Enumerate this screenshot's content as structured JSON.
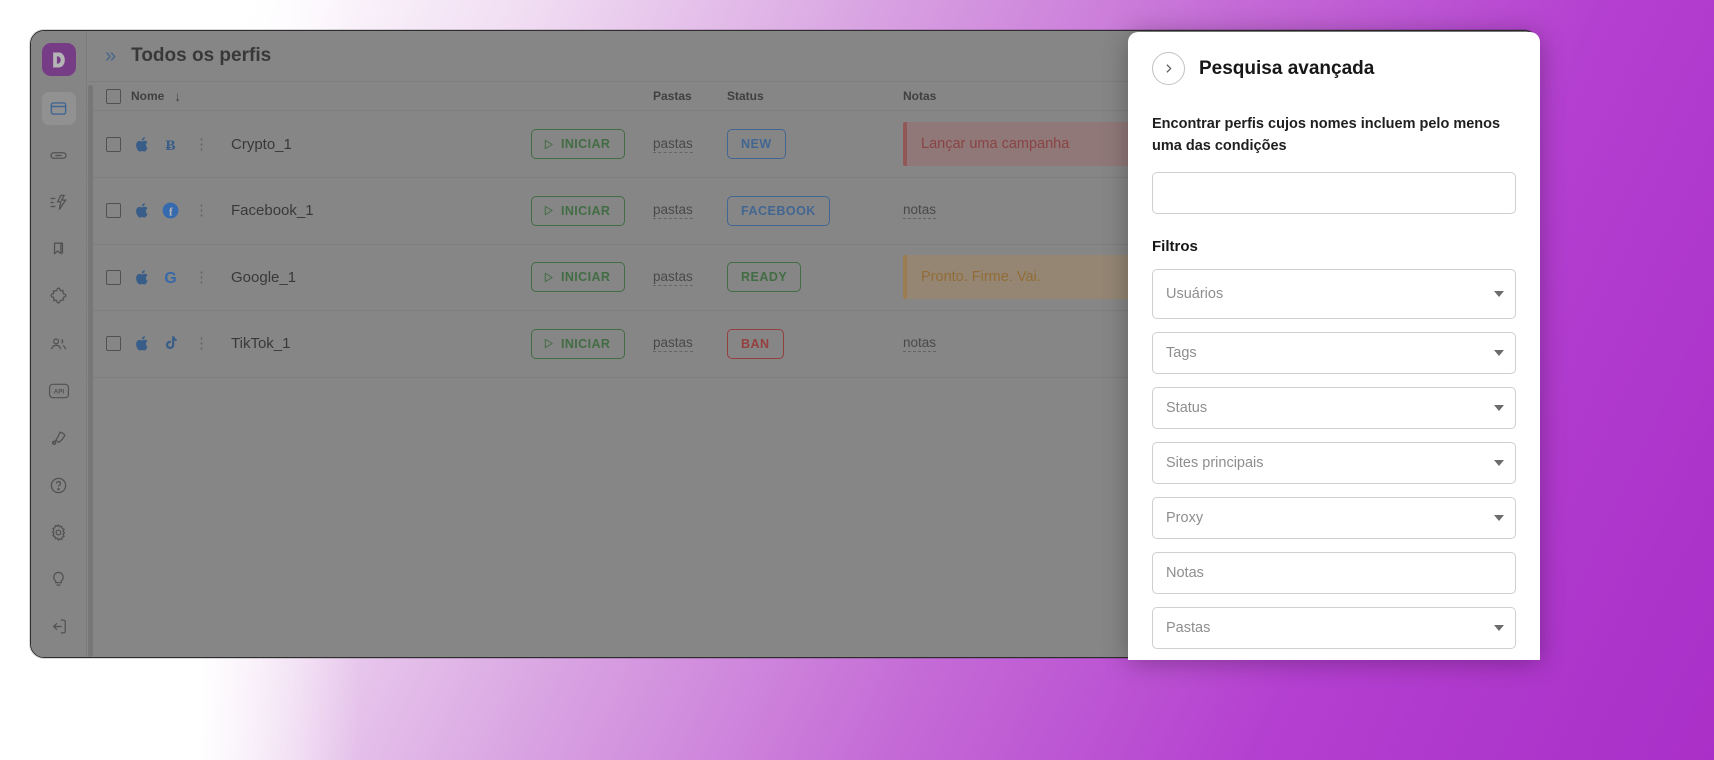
{
  "app": {
    "logo_icon": "dolphin-anty-logo",
    "sidebar_items": [
      {
        "icon": "browser-profiles-icon",
        "name": "sidebar-item-profiles",
        "active": true
      },
      {
        "icon": "link-icon",
        "name": "sidebar-item-proxies",
        "active": false
      },
      {
        "icon": "automation-icon",
        "name": "sidebar-item-automation",
        "active": false
      },
      {
        "icon": "bookmarks-icon",
        "name": "sidebar-item-bookmarks",
        "active": false
      },
      {
        "icon": "extension-puzzle-icon",
        "name": "sidebar-item-extensions",
        "active": false
      },
      {
        "icon": "team-users-icon",
        "name": "sidebar-item-team",
        "active": false
      },
      {
        "icon": "api-icon",
        "name": "sidebar-item-api",
        "active": false,
        "label": "API"
      },
      {
        "icon": "rocket-icon",
        "name": "sidebar-item-rocket",
        "active": false
      },
      {
        "icon": "help-question-icon",
        "name": "sidebar-item-help",
        "active": false
      },
      {
        "icon": "gear-icon",
        "name": "sidebar-item-settings",
        "active": false
      },
      {
        "icon": "lightbulb-icon",
        "name": "sidebar-item-ideas",
        "active": false
      },
      {
        "icon": "logout-icon",
        "name": "sidebar-item-logout",
        "active": false
      }
    ]
  },
  "header": {
    "expand_icon": "double-chevron-right-icon",
    "title": "Todos os perfis",
    "actions": [
      {
        "icon": "plus-icon",
        "name": "add-profile-button"
      },
      {
        "icon": "filter-icon",
        "name": "filter-button"
      },
      {
        "icon": "refresh-icon",
        "name": "refresh-button"
      }
    ]
  },
  "table": {
    "columns": {
      "name": "Nome",
      "sort_icon": "arrow-down-icon",
      "pastas": "Pastas",
      "status": "Status",
      "notas": "Notas"
    },
    "rows": [
      {
        "name": "Crypto_1",
        "platform_icons": [
          "apple-icon",
          "bitcoin-icon"
        ],
        "start_label": "INICIAR",
        "folders_label": "pastas",
        "status": "NEW",
        "status_color": "blue",
        "note": "Lançar uma campanha",
        "note_style": "red"
      },
      {
        "name": "Facebook_1",
        "platform_icons": [
          "apple-icon",
          "facebook-icon"
        ],
        "start_label": "INICIAR",
        "folders_label": "pastas",
        "status": "FACEBOOK",
        "status_color": "blue",
        "note": "notas",
        "note_style": "link"
      },
      {
        "name": "Google_1",
        "platform_icons": [
          "apple-icon",
          "google-icon"
        ],
        "start_label": "INICIAR",
        "folders_label": "pastas",
        "status": "READY",
        "status_color": "green",
        "note": "Pronto. Firme. Vai.",
        "note_style": "amber"
      },
      {
        "name": "TikTok_1",
        "platform_icons": [
          "apple-icon",
          "tiktok-icon"
        ],
        "start_label": "INICIAR",
        "folders_label": "pastas",
        "status": "BAN",
        "status_color": "red",
        "note": "notas",
        "note_style": "link"
      }
    ]
  },
  "panel": {
    "back_icon": "chevron-right-icon",
    "title": "Pesquisa avançada",
    "description": "Encontrar perfis cujos nomes incluem pelo menos uma das condições",
    "search_value": "",
    "search_placeholder": "",
    "filters_title": "Filtros",
    "fields": [
      {
        "name": "filter-usuarios",
        "placeholder": "Usuários",
        "type": "select",
        "value": ""
      },
      {
        "name": "filter-tags",
        "placeholder": "Tags",
        "type": "select",
        "value": ""
      },
      {
        "name": "filter-status",
        "placeholder": "Status",
        "type": "select",
        "value": ""
      },
      {
        "name": "filter-sites-principais",
        "placeholder": "Sites principais",
        "type": "select",
        "value": ""
      },
      {
        "name": "filter-proxy",
        "placeholder": "Proxy",
        "type": "select",
        "value": ""
      },
      {
        "name": "filter-notas",
        "placeholder": "Notas",
        "type": "text",
        "value": ""
      },
      {
        "name": "filter-pastas",
        "placeholder": "Pastas",
        "type": "select",
        "value": ""
      }
    ]
  },
  "colors": {
    "brand_purple": "#8e24aa",
    "accent_blue": "#2f6fbf",
    "green": "#2e7d32",
    "red": "#c62828",
    "amber": "#c07b18"
  }
}
